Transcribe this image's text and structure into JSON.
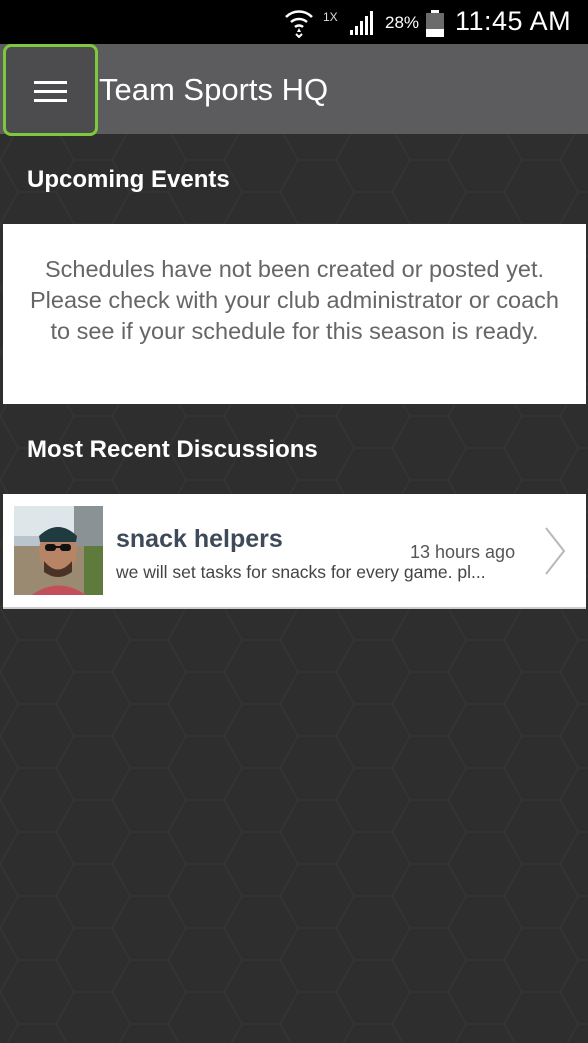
{
  "status_bar": {
    "network_type": "1X",
    "battery_percent": "28%",
    "time": "11:45 AM",
    "icons": [
      "wifi-icon",
      "signal-icon",
      "battery-icon"
    ]
  },
  "app_bar": {
    "title": "Team Sports HQ",
    "menu_icon": "hamburger-menu-icon",
    "highlight_color": "#7ec83c"
  },
  "upcoming_events": {
    "header": "Upcoming Events",
    "message": "Schedules have not been created or posted yet. Please check with your club administrator or coach to see if your schedule for this season is ready."
  },
  "discussions": {
    "header": "Most Recent Discussions",
    "items": [
      {
        "title": "snack helpers",
        "time": "13 hours ago",
        "snippet": "we will set tasks for snacks for every game. pl...",
        "avatar_icon": "user-avatar-photo"
      }
    ]
  },
  "colors": {
    "background": "#2f2e2f",
    "app_bar": "#5c5b5d",
    "card": "#ffffff",
    "title_text": "#3e4a5a"
  }
}
